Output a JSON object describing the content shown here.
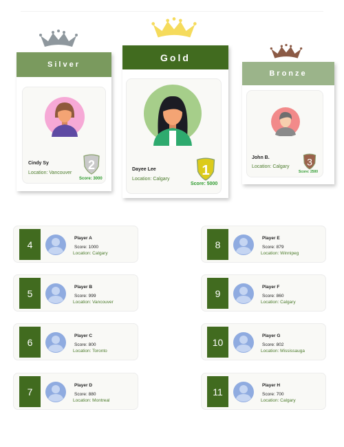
{
  "podium": {
    "silver": {
      "title": "Silver",
      "name": "Cindy Sy",
      "location": "Location: Vancouver",
      "score": "Score: 3000",
      "rank": "2",
      "header_color": "#7a9a5e",
      "crown_color": "#8e979d"
    },
    "gold": {
      "title": "Gold",
      "name": "Dayee Lee",
      "location": "Location: Calgary",
      "score": "Score: 5000",
      "rank": "1",
      "header_color": "#416b1f",
      "crown_color": "#f5db5c"
    },
    "bronze": {
      "title": "Bronze",
      "name": "John B.",
      "location": "Location: Calgary",
      "score": "Score: 2500",
      "rank": "3",
      "header_color": "#9bb48a",
      "crown_color": "#8b5a45"
    }
  },
  "players": [
    {
      "rank": "4",
      "name": "Player A",
      "score": "Score: 1000",
      "location": "Location: Calgary"
    },
    {
      "rank": "5",
      "name": "Player B",
      "score": "Score: 999",
      "location": "Location: Vancouver"
    },
    {
      "rank": "6",
      "name": "Player C",
      "score": "Score: 800",
      "location": "Location: Toronto"
    },
    {
      "rank": "7",
      "name": "Player D",
      "score": "Score: 880",
      "location": "Location: Montreal"
    },
    {
      "rank": "8",
      "name": "Player E",
      "score": "Score: 879",
      "location": "Location: Winnipeg"
    },
    {
      "rank": "9",
      "name": "Player F",
      "score": "Score: 860",
      "location": "Location: Calgary"
    },
    {
      "rank": "10",
      "name": "Player G",
      "score": "Score: 802",
      "location": "Location: Mississauga"
    },
    {
      "rank": "11",
      "name": "Player H",
      "score": "Score: 700",
      "location": "Location: Calgary"
    }
  ]
}
